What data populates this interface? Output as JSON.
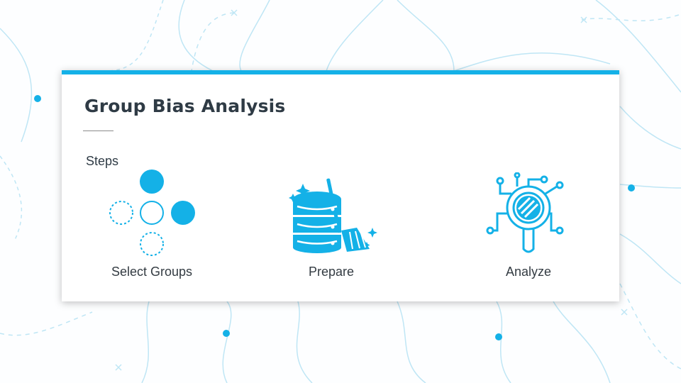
{
  "page": {
    "title": "Group Bias Analysis",
    "steps_heading": "Steps"
  },
  "steps": [
    {
      "label": "Select Groups",
      "icon": "group-circles-icon"
    },
    {
      "label": "Prepare",
      "icon": "database-broom-icon"
    },
    {
      "label": "Analyze",
      "icon": "magnifier-circuit-icon"
    }
  ],
  "colors": {
    "accent": "#14b1e7",
    "title_text": "#2f3b45",
    "background_lines": "#b9e3f4"
  }
}
